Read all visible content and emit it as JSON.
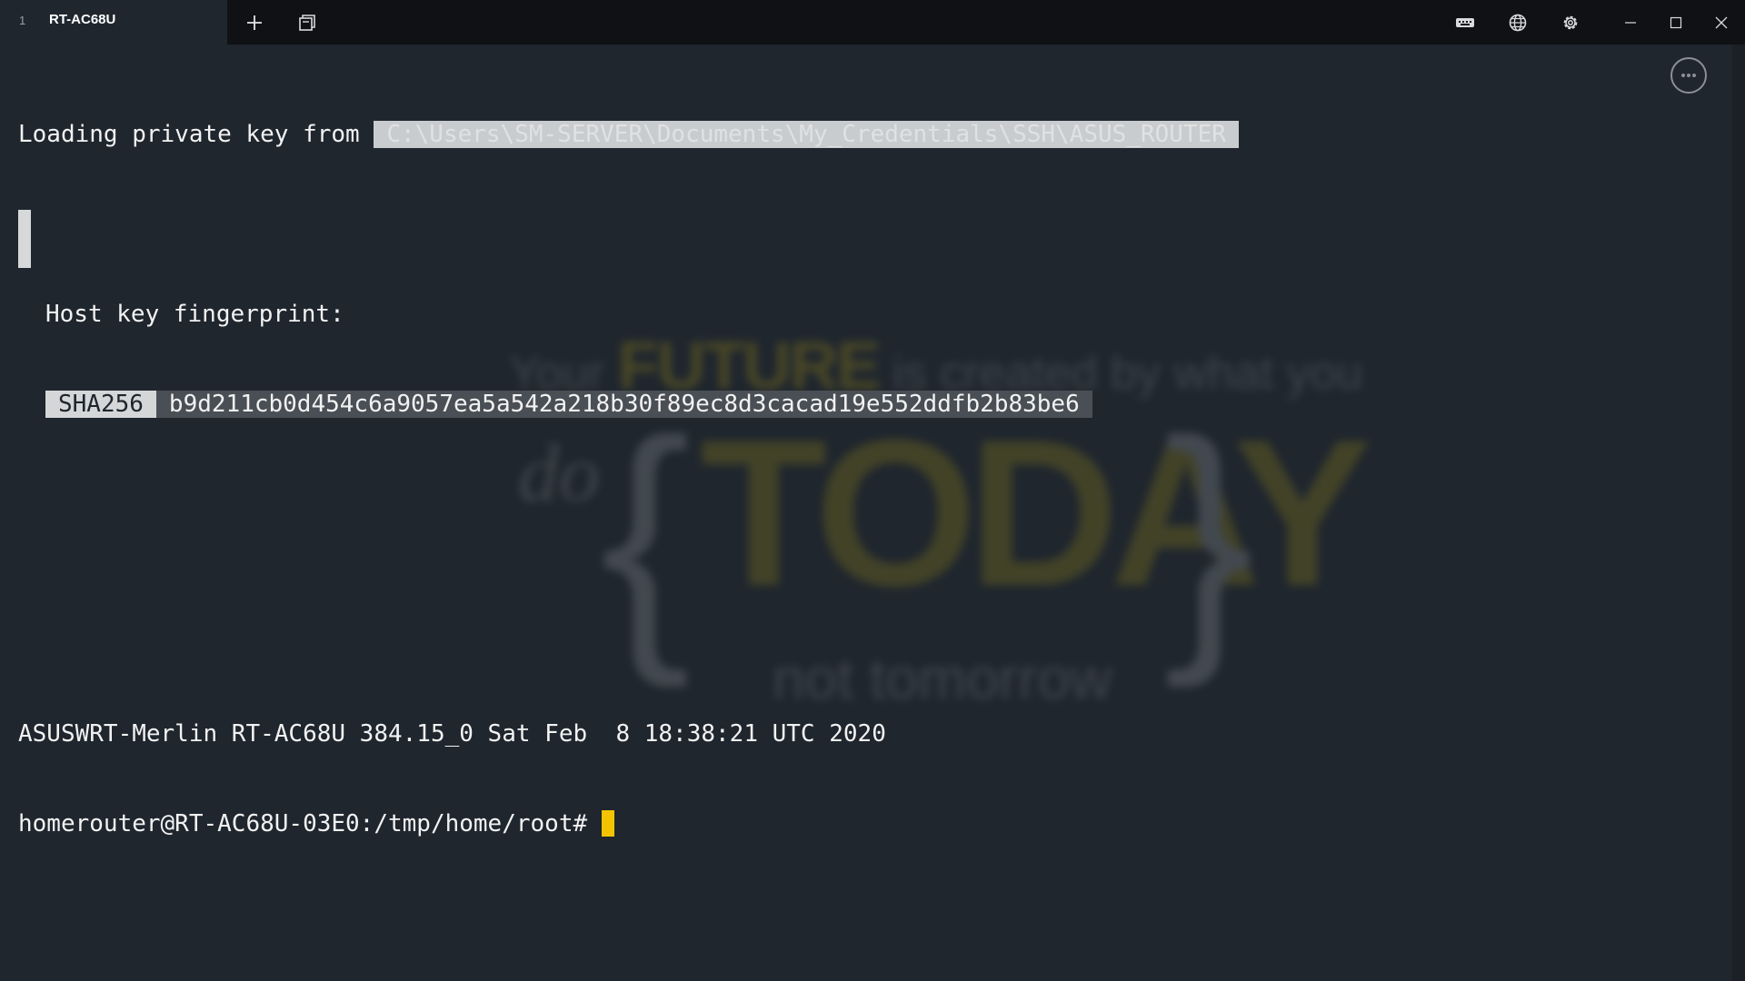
{
  "tab": {
    "index": "1",
    "title": "RT-AC68U"
  },
  "titlebar": {
    "new_tab_icon": "plus-icon",
    "duplicate_tab_icon": "duplicate-tab-icon",
    "keyboard_icon": "keyboard-icon",
    "globe_icon": "globe-icon",
    "settings_icon": "gear-icon",
    "minimize_icon": "minimize-icon",
    "maximize_icon": "maximize-icon",
    "close_icon": "close-icon"
  },
  "terminal": {
    "line1_prefix": "Loading private key from",
    "key_path": "C:\\Users\\SM-SERVER\\Documents\\My_Credentials\\SSH\\ASUS_ROUTER",
    "host_key_label": "Host key fingerprint:",
    "sha_label": "SHA256",
    "sha_value": "b9d211cb0d454c6a9057ea5a542a218b30f89ec8d3cacad19e552ddfb2b83be6",
    "banner": "ASUSWRT-Merlin RT-AC68U 384.15_0 Sat Feb  8 18:38:21 UTC 2020",
    "prompt": "homerouter@RT-AC68U-03E0:/tmp/home/root#"
  },
  "wallpaper": {
    "line1_a": "Your",
    "line1_future": "FUTURE",
    "line1_b": "is created by what you",
    "do": "do",
    "brace_left": "{",
    "today": "TODAY",
    "brace_right": "}",
    "not_tomorrow": "not tomorrow"
  },
  "colors": {
    "background": "#1f262e",
    "titlebar": "#0f1114",
    "cursor": "#f5c400"
  }
}
